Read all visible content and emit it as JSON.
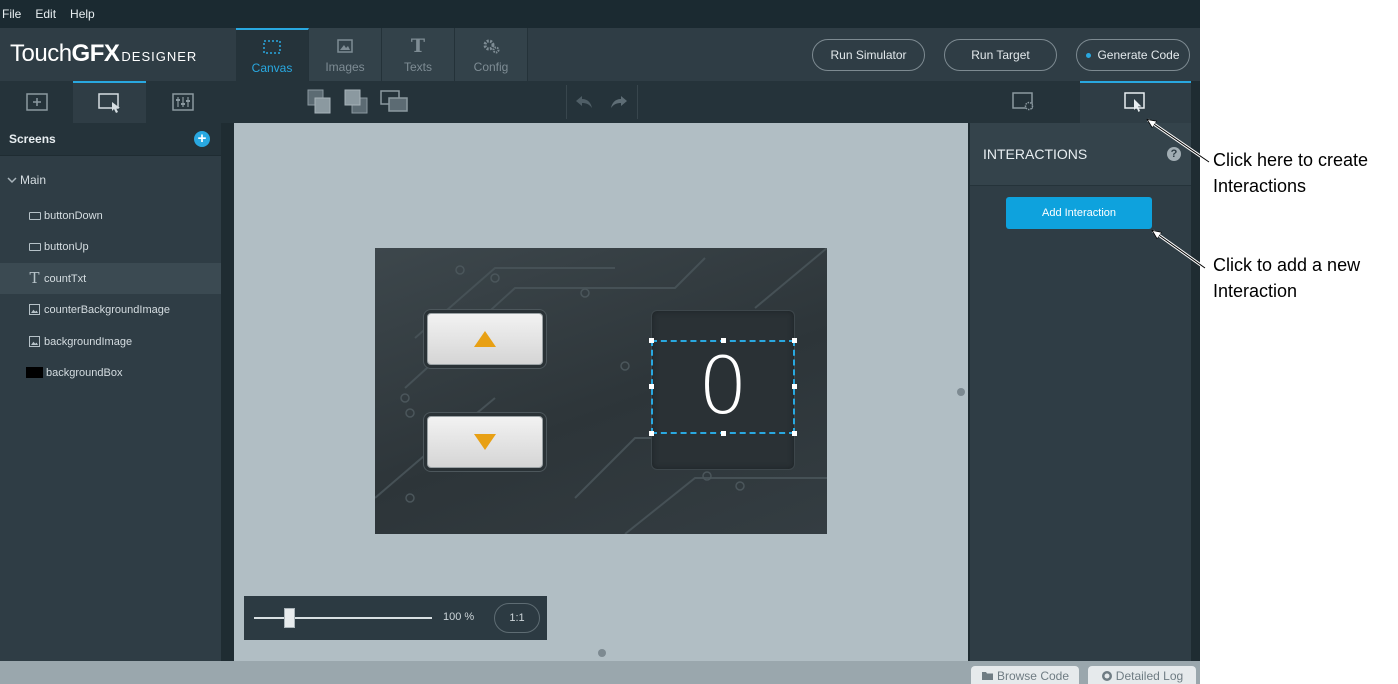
{
  "menu": [
    "File",
    "Edit",
    "Help"
  ],
  "logo": {
    "part1": "Touch",
    "part2": "GFX",
    "part3": "DESIGNER"
  },
  "tabs": [
    {
      "label": "Canvas",
      "icon": "canvas-icon"
    },
    {
      "label": "Images",
      "icon": "images-icon"
    },
    {
      "label": "Texts",
      "icon": "texts-icon",
      "glyph": "T"
    },
    {
      "label": "Config",
      "icon": "config-icon"
    }
  ],
  "header_buttons": {
    "run_simulator": "Run Simulator",
    "run_target": "Run Target",
    "generate_code": "Generate Code"
  },
  "screens_panel": {
    "title": "Screens",
    "add_symbol": "+",
    "main_screen": "Main",
    "widgets": [
      {
        "label": "buttonDown",
        "icon": "button-icon"
      },
      {
        "label": "buttonUp",
        "icon": "button-icon"
      },
      {
        "label": "countTxt",
        "icon": "text-icon",
        "glyph": "T"
      },
      {
        "label": "counterBackgroundImage",
        "icon": "image-icon"
      },
      {
        "label": "backgroundImage",
        "icon": "image-icon"
      },
      {
        "label": "backgroundBox",
        "icon": "box-icon"
      }
    ]
  },
  "canvas": {
    "count_value": "0"
  },
  "zoom": {
    "percent": "100 %",
    "one_to_one": "1:1",
    "slider_level": 0.2
  },
  "interactions_panel": {
    "title": "INTERACTIONS",
    "help_symbol": "?",
    "add_button": "Add Interaction"
  },
  "bottom": {
    "browse_code": "Browse Code",
    "detailed_log": "Detailed Log"
  },
  "annotations": {
    "create_line1": "Click here to create",
    "create_line2": "Interactions",
    "add_line1": "Click to add a new",
    "add_line2": "Interaction"
  },
  "colors": {
    "accent": "#29a8e0",
    "button_blue": "#0ea2dd",
    "arrow_orange": "#e8a014"
  }
}
